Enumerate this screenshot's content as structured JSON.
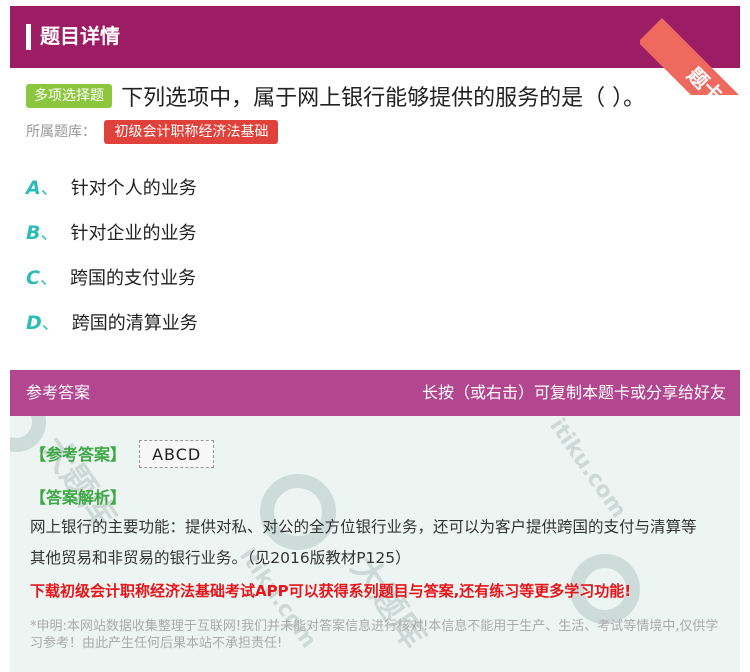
{
  "header": {
    "title": "题目详情",
    "ribbon": "题卡"
  },
  "question": {
    "type": "多项选择题",
    "text": "下列选项中，属于网上银行能够提供的服务的是（ ）。"
  },
  "bank": {
    "label": "所属题库：",
    "name": "初级会计职称经济法基础"
  },
  "options": [
    {
      "letter": "A",
      "sep": "、",
      "text": "针对个人的业务"
    },
    {
      "letter": "B",
      "sep": "、",
      "text": "针对企业的业务"
    },
    {
      "letter": "C",
      "sep": "、",
      "text": "跨国的支付业务"
    },
    {
      "letter": "D",
      "sep": "、",
      "text": "跨国的清算业务"
    }
  ],
  "answer_section": {
    "title": "参考答案",
    "hint": "长按（或右击）可复制本题卡或分享给好友",
    "answer_label": "【参考答案】",
    "answer_value": "ABCD",
    "analysis_label": "【答案解析】",
    "analysis_text": "网上银行的主要功能：提供对私、对公的全方位银行业务，还可以为客户提供跨国的支付与清算等其他贸易和非贸易的银行业务。（见2016版教材P125）",
    "promo": "下载初级会计职称经济法基础考试APP可以获得系列题目与答案,还有练习等更多学习功能!",
    "disclaimer": "*申明:本网站数据收集整理于互联网!我们并未能对答案信息进行核对!本信息不能用于生产、生活、考试等情境中,仅供学习参考！由此产生任何后果本站不承担责任!"
  },
  "watermark": {
    "text1": "大题库",
    "text2": "itiku.com"
  }
}
